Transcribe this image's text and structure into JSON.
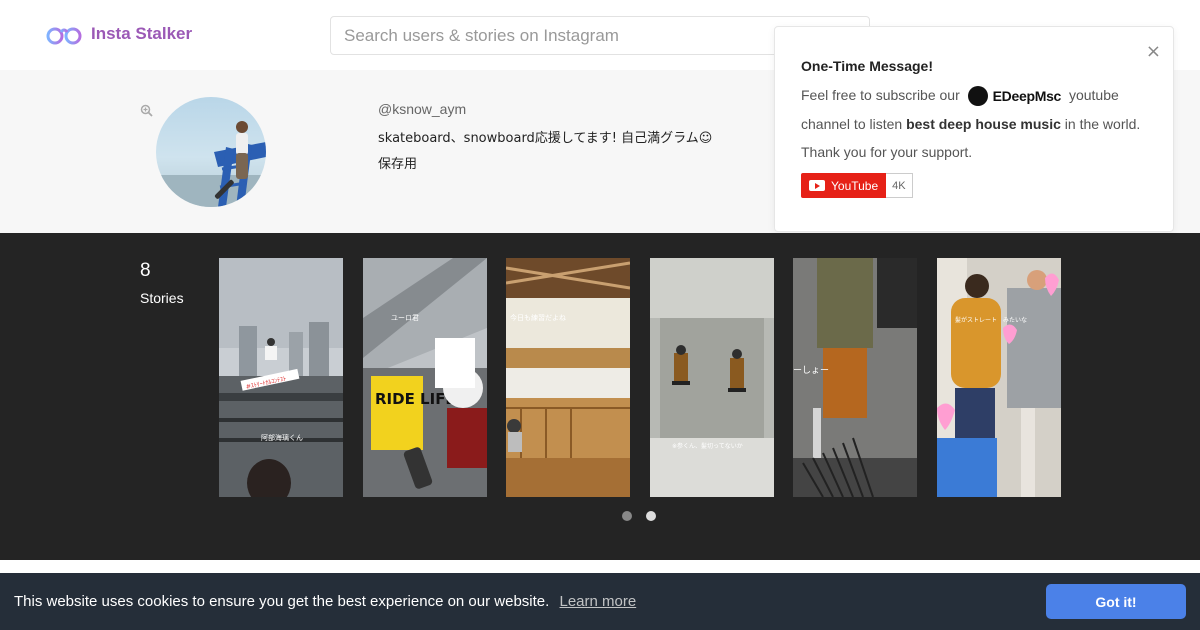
{
  "header": {
    "brand": "Insta Stalker",
    "search_placeholder": "Search users & stories on Instagram"
  },
  "profile": {
    "username": "@ksnow_aym",
    "bio_line1": "skateboard、snowboard応援してます! 自己満グラム☺︎",
    "bio_line2": "保存用"
  },
  "stories": {
    "count": "8",
    "label": "Stories",
    "items": [
      {
        "caption": "阿部海璃くん",
        "sticker": "#ｽﾄﾘｰﾄｶﾙｺﾝﾃｽﾄ"
      },
      {
        "caption": "ユーロ君",
        "sticker": "RIDE LIFE"
      },
      {
        "caption": "今日も練習だよね"
      },
      {
        "caption": "※参くん、髪切ってないか"
      },
      {
        "caption": "ーしょー"
      },
      {
        "caption": "髪がストレート　みたいな"
      }
    ],
    "page_dots": 2,
    "active_dot": 1
  },
  "popup": {
    "title": "One-Time Message!",
    "body_before": "Feel free to subscribe our",
    "brand_name": "EDeepMsc",
    "body_after": "youtube channel to listen",
    "body_bold": "best deep house music",
    "body_end": "in the world. Thank you for your support.",
    "close": "×",
    "youtube_label": "YouTube",
    "youtube_count": "4K"
  },
  "cookie": {
    "message": "This website uses cookies to ensure you get the best experience on our website.",
    "link": "Learn more",
    "button": "Got it!"
  },
  "colors": {
    "brand": "#9b59b6",
    "band": "#242424",
    "cookie_bg": "#252e39",
    "cookie_btn": "#4b81e8",
    "youtube": "#e62117"
  }
}
